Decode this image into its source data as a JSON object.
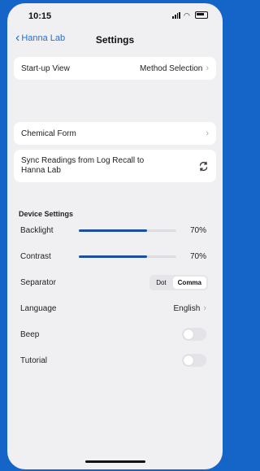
{
  "status": {
    "time": "10:15"
  },
  "nav": {
    "back_label": "Hanna Lab",
    "title": "Settings"
  },
  "startup": {
    "label": "Start-up View",
    "value": "Method Selection"
  },
  "startup_note": "",
  "chemical": {
    "label": "Chemical Form"
  },
  "sync": {
    "label_line1": "Sync Readings from Log Recall to",
    "label_line2": "Hanna Lab"
  },
  "sync_note": "",
  "device_settings": {
    "section_title": "Device Settings",
    "backlight": {
      "label": "Backlight",
      "value_text": "70%",
      "level": 0.7
    },
    "contrast": {
      "label": "Contrast",
      "value_text": "70%",
      "level": 0.7
    },
    "separator": {
      "label": "Separator",
      "options": [
        "Dot",
        "Comma"
      ],
      "selected": "Comma"
    },
    "language": {
      "label": "Language",
      "value": "English"
    },
    "beep": {
      "label": "Beep"
    },
    "tutorial": {
      "label": "Tutorial"
    }
  },
  "colors": {
    "accent": "#1e6fd9",
    "slider": "#1a4fa3",
    "backdrop": "#1565c8"
  },
  "icons": {
    "back": "chevron-left-icon",
    "chevron": "chevron-right-icon",
    "sync": "sync-icon"
  }
}
